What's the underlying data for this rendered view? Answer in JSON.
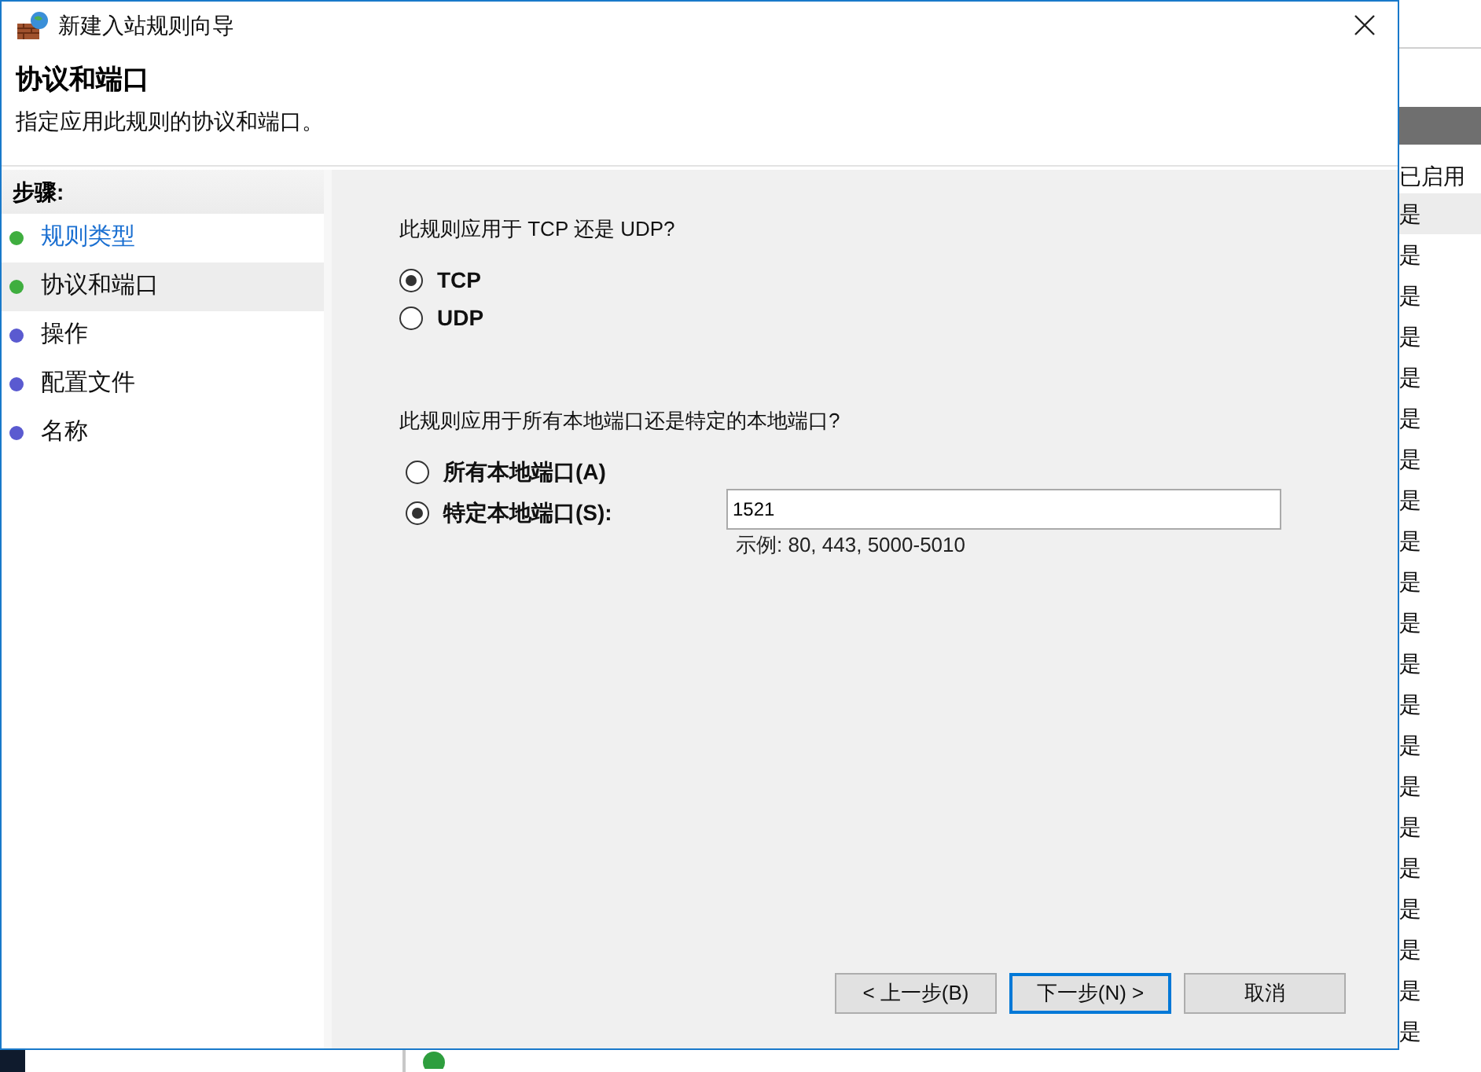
{
  "window": {
    "title": "新建入站规则向导"
  },
  "header": {
    "title": "协议和端口",
    "subtitle": "指定应用此规则的协议和端口。"
  },
  "steps": {
    "title": "步骤:",
    "items": [
      {
        "label": "规则类型",
        "color": "#3fae3f",
        "selected": false,
        "link": true
      },
      {
        "label": "协议和端口",
        "color": "#3fae3f",
        "selected": true,
        "link": false
      },
      {
        "label": "操作",
        "color": "#5a5ad0",
        "selected": false,
        "link": false
      },
      {
        "label": "配置文件",
        "color": "#5a5ad0",
        "selected": false,
        "link": false
      },
      {
        "label": "名称",
        "color": "#5a5ad0",
        "selected": false,
        "link": false
      }
    ]
  },
  "protocol": {
    "question": "此规则应用于 TCP 还是 UDP?",
    "options": [
      {
        "label": "TCP",
        "selected": true
      },
      {
        "label": "UDP",
        "selected": false
      }
    ]
  },
  "ports": {
    "question": "此规则应用于所有本地端口还是特定的本地端口?",
    "options": [
      {
        "label": "所有本地端口(A)",
        "selected": false
      },
      {
        "label": "特定本地端口(S):",
        "selected": true
      }
    ],
    "value": "1521",
    "example": "示例: 80, 443, 5000-5010"
  },
  "buttons": [
    {
      "label": "< 上一步(B)",
      "default": false
    },
    {
      "label": "下一步(N) >",
      "default": true
    },
    {
      "label": "取消",
      "default": false
    }
  ],
  "background_window": {
    "column_header": "已启用",
    "cells": [
      "是",
      "是",
      "是",
      "是",
      "是",
      "是",
      "是",
      "是",
      "是",
      "是",
      "是",
      "是",
      "是",
      "是",
      "是",
      "是",
      "是",
      "是",
      "是",
      "是",
      "是"
    ]
  }
}
